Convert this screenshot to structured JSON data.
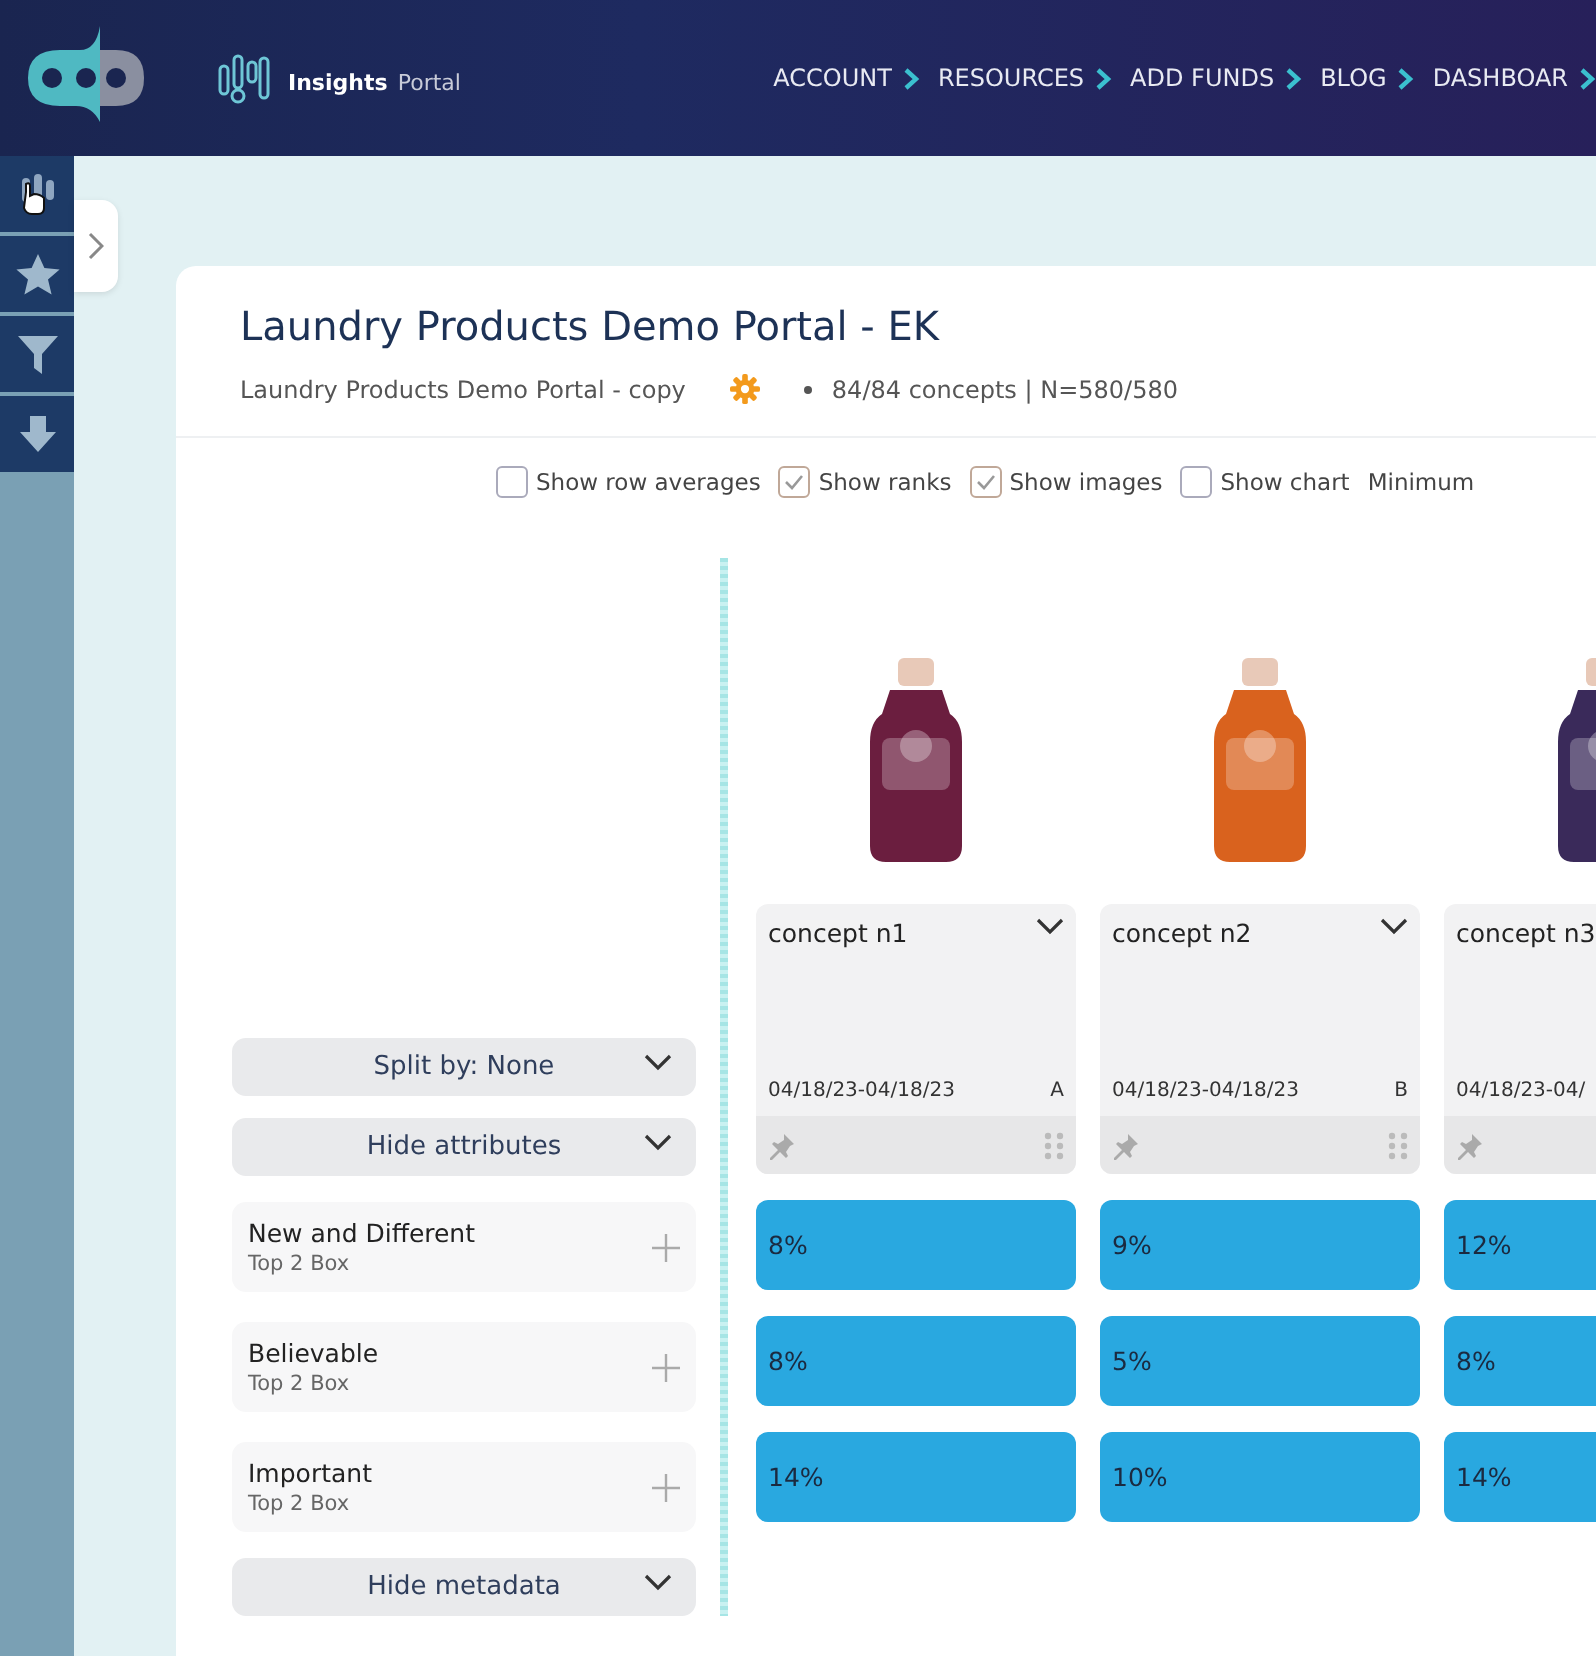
{
  "header": {
    "brand": "Insights",
    "brand_suffix": "Portal",
    "nav": [
      "ACCOUNT",
      "RESOURCES",
      "ADD FUNDS",
      "BLOG",
      "DASHBOAR"
    ]
  },
  "page": {
    "title": "Laundry Products Demo Portal - EK",
    "subtitle": "Laundry Products Demo Portal - copy",
    "stats": "84/84 concepts | N=580/580"
  },
  "options": [
    {
      "label": "Show row averages",
      "checked": false
    },
    {
      "label": "Show ranks",
      "checked": true
    },
    {
      "label": "Show images",
      "checked": true
    },
    {
      "label": "Show chart",
      "checked": false
    }
  ],
  "options_more": "Minimum",
  "controls": {
    "split": "Split by: None",
    "hide_attributes": "Hide attributes",
    "hide_metadata": "Hide metadata"
  },
  "concepts": [
    {
      "name": "concept n1",
      "date": "04/18/23-04/18/23",
      "rank": "A",
      "color": "#6b1e3f"
    },
    {
      "name": "concept n2",
      "date": "04/18/23-04/18/23",
      "rank": "B",
      "color": "#d9621e"
    },
    {
      "name": "concept n3",
      "date": "04/18/23-04/",
      "color": "#3a2a5a"
    }
  ],
  "attributes": [
    {
      "name": "New and Different",
      "metric": "Top 2 Box",
      "values": [
        "8%",
        "9%",
        "12%"
      ]
    },
    {
      "name": "Believable",
      "metric": "Top 2 Box",
      "values": [
        "8%",
        "5%",
        "8%"
      ]
    },
    {
      "name": "Important",
      "metric": "Top 2 Box",
      "values": [
        "14%",
        "10%",
        "14%"
      ]
    }
  ]
}
